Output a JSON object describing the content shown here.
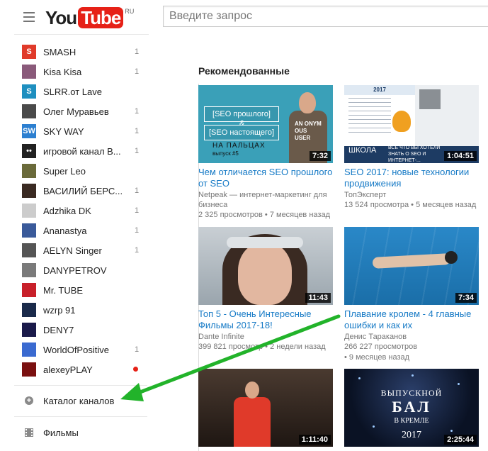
{
  "header": {
    "logo_you": "You",
    "logo_tube": "Tube",
    "logo_region": "RU",
    "search_placeholder": "Введите запрос"
  },
  "sidebar": {
    "subscriptions": [
      {
        "label": "SMASH",
        "count": "1",
        "avatar_color": "#e03a2a",
        "avatar_text": "S"
      },
      {
        "label": "Kisa Kisa",
        "count": "1",
        "avatar_color": "#8a5a7a",
        "avatar_text": ""
      },
      {
        "label": "SLRR.от Lave",
        "count": "",
        "avatar_color": "#1e8fbf",
        "avatar_text": "S"
      },
      {
        "label": "Олег Муравьев",
        "count": "1",
        "avatar_color": "#4a4a4a",
        "avatar_text": ""
      },
      {
        "label": "SKY WAY",
        "count": "1",
        "avatar_color": "#2c7fd0",
        "avatar_text": "SW"
      },
      {
        "label": "игровой канал В...",
        "count": "1",
        "avatar_color": "#222222",
        "avatar_text": "••"
      },
      {
        "label": "Super Leo",
        "count": "",
        "avatar_color": "#6a6a3a",
        "avatar_text": ""
      },
      {
        "label": "ВАСИЛИЙ БЕРС...",
        "count": "1",
        "avatar_color": "#3a2a22",
        "avatar_text": ""
      },
      {
        "label": "Adzhika DK",
        "count": "1",
        "avatar_color": "#cccccc",
        "avatar_text": ""
      },
      {
        "label": "Ananastya",
        "count": "1",
        "avatar_color": "#3a5a9a",
        "avatar_text": ""
      },
      {
        "label": "AELYN Singer",
        "count": "1",
        "avatar_color": "#555555",
        "avatar_text": ""
      },
      {
        "label": "DANYPETROV",
        "count": "",
        "avatar_color": "#7a7a7a",
        "avatar_text": ""
      },
      {
        "label": "Mr. TUBE",
        "count": "",
        "avatar_color": "#c8202a",
        "avatar_text": ""
      },
      {
        "label": "wzrp 91",
        "count": "",
        "avatar_color": "#1a2a4a",
        "avatar_text": ""
      },
      {
        "label": "DENY7",
        "count": "",
        "avatar_color": "#1a1a4a",
        "avatar_text": ""
      },
      {
        "label": "WorldOfPositive",
        "count": "1",
        "avatar_color": "#3a6ad0",
        "avatar_text": ""
      },
      {
        "label": "alexeyPLAY",
        "count": "",
        "avatar_color": "#7a1010",
        "avatar_text": "",
        "dot": true
      }
    ],
    "catalog_label": "Каталог каналов",
    "films_label": "Фильмы"
  },
  "main": {
    "section_title": "Рекомендованные",
    "videos": [
      {
        "title": "Чем отличается SEO прошлого от SEO",
        "channel": "Netpeak — интернет-маркетинг для бизнеса",
        "views": "2 325 просмотров",
        "age": "7 месяцев назад",
        "duration": "7:32",
        "thumb": {
          "box1": "[SEO прошлого]",
          "amp": "&",
          "box2": "[SEO настоящего]",
          "caption1": "НА ПАЛЬЦАХ",
          "caption2": "выпуск #5",
          "shirt": "AN ONYM OUS USER"
        }
      },
      {
        "title": "SEO 2017: новые технологии продвижения",
        "channel": "ТопЭксперт",
        "views": "13 524 просмотра",
        "age": "5 месяцев назад",
        "duration": "1:04:51",
        "thumb": {
          "year": "2017",
          "banner1": "ШКОЛА",
          "banner2": "ВСЁ ЧТО ВЫ ХОТЕЛИ ЗНАТЬ О SEO И ИНТЕРНЕТ-..."
        }
      },
      {
        "title": "Топ 5 - Очень Интересные Фильмы 2017-18!",
        "channel": "Dante Infinite",
        "views": "399 821 просмотр",
        "age": "2 недели назад",
        "duration": "11:43",
        "thumb": {}
      },
      {
        "title": "Плавание кролем - 4 главные ошибки и как их",
        "channel": "Денис Тараканов",
        "views": "266 227 просмотров",
        "age": "9 месяцев назад",
        "duration": "7:34",
        "thumb": {}
      },
      {
        "title": "",
        "channel": "",
        "views": "",
        "age": "",
        "duration": "1:11:40",
        "thumb": {}
      },
      {
        "title": "",
        "channel": "",
        "views": "",
        "age": "",
        "duration": "2:25:44",
        "thumb": {
          "line1": "ВЫПУСКНОЙ",
          "line2": "БАЛ",
          "line3": "В КРЕМЛЕ",
          "line4": "2017"
        }
      }
    ]
  },
  "colors": {
    "brand_red": "#e62117",
    "link_blue": "#167ac6",
    "annotation_arrow": "#22b32a"
  }
}
